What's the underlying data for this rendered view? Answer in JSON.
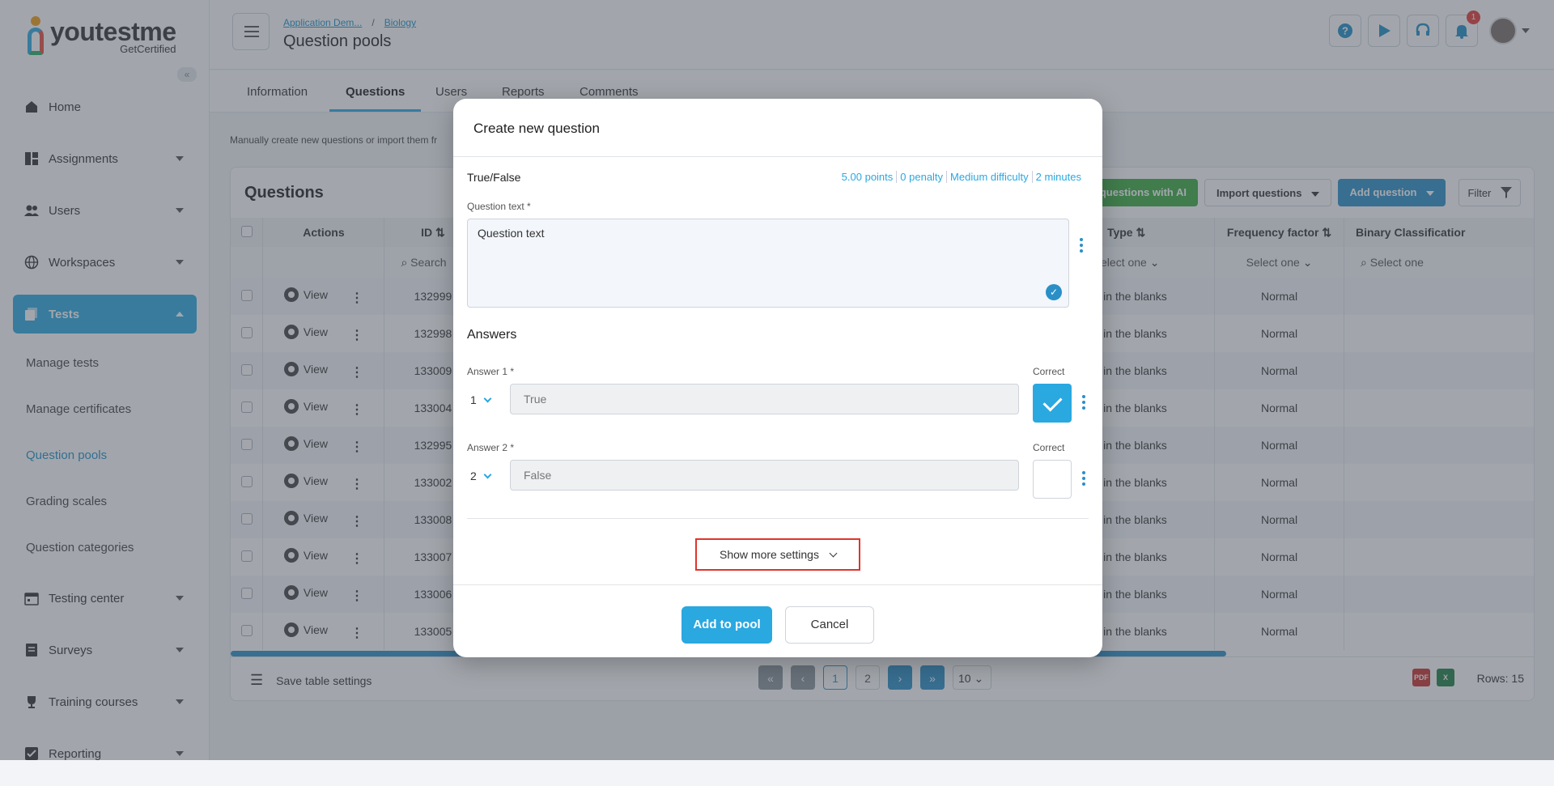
{
  "brand": {
    "name": "youtestme",
    "tagline": "GetCertified"
  },
  "sidebar": {
    "items": [
      {
        "label": "Home",
        "icon": "home-icon"
      },
      {
        "label": "Assignments",
        "icon": "assignments-icon"
      },
      {
        "label": "Users",
        "icon": "users-icon"
      },
      {
        "label": "Workspaces",
        "icon": "globe-icon"
      },
      {
        "label": "Tests",
        "icon": "tests-icon"
      }
    ],
    "sub_items": [
      "Manage tests",
      "Manage certificates",
      "Question pools",
      "Grading scales",
      "Question categories"
    ],
    "items_after": [
      {
        "label": "Testing center",
        "icon": "calendar-icon"
      },
      {
        "label": "Surveys",
        "icon": "surveys-icon"
      },
      {
        "label": "Training courses",
        "icon": "trophy-icon"
      },
      {
        "label": "Reporting",
        "icon": "report-icon"
      }
    ]
  },
  "header": {
    "breadcrumb": [
      "Application Dem...",
      "Biology"
    ],
    "title": "Question pools",
    "notification_count": "1"
  },
  "tabs": [
    "Information",
    "Questions",
    "Users",
    "Reports",
    "Comments"
  ],
  "main": {
    "hint": "Manually create new questions or import them fr",
    "card_title": "Questions",
    "buttons": {
      "ai": "questions with AI",
      "import": "Import questions",
      "add": "Add question",
      "filter": "Filter"
    },
    "columns": [
      "Actions",
      "ID",
      "Type",
      "Frequency factor",
      "Binary Classificatior"
    ],
    "filters": {
      "search": "Search",
      "select": "Select one"
    },
    "rows": [
      {
        "id": "132999",
        "type": "Fill in the blanks",
        "freq": "Normal"
      },
      {
        "id": "132998",
        "type": "Fill in the blanks",
        "freq": "Normal"
      },
      {
        "id": "133009",
        "type": "Fill in the blanks",
        "freq": "Normal"
      },
      {
        "id": "133004",
        "type": "Fill in the blanks",
        "freq": "Normal"
      },
      {
        "id": "132995",
        "type": "Fill in the blanks",
        "freq": "Normal"
      },
      {
        "id": "133002",
        "type": "Fill in the blanks",
        "freq": "Normal"
      },
      {
        "id": "133008",
        "type": "Fill in the blanks",
        "freq": "Normal"
      },
      {
        "id": "133007",
        "type": "Fill in the blanks",
        "freq": "Normal"
      },
      {
        "id": "133006",
        "type": "Fill in the blanks",
        "freq": "Normal"
      },
      {
        "id": "133005",
        "type": "Fill in the blanks",
        "freq": "Normal"
      }
    ],
    "view_label": "View",
    "footer": {
      "save_settings": "Save table settings",
      "pages": [
        "1",
        "2"
      ],
      "page_size": "10",
      "rows": "Rows: 15"
    }
  },
  "modal": {
    "title": "Create new question",
    "question_type": "True/False",
    "meta": [
      "5.00 points",
      "0 penalty",
      "Medium difficulty",
      "2 minutes"
    ],
    "question_text_label": "Question text *",
    "question_text": "Question text",
    "answers_heading": "Answers",
    "correct_label": "Correct",
    "answers": [
      {
        "label": "Answer 1 *",
        "number": "1",
        "placeholder": "True",
        "correct": true
      },
      {
        "label": "Answer 2 *",
        "number": "2",
        "placeholder": "False",
        "correct": false
      }
    ],
    "show_more": "Show more settings",
    "add_button": "Add to pool",
    "cancel_button": "Cancel"
  },
  "colors": {
    "accent": "#2aa8e0",
    "primary": "#2a8fc7",
    "green": "#3aab3f",
    "highlight": "#e0342c"
  }
}
